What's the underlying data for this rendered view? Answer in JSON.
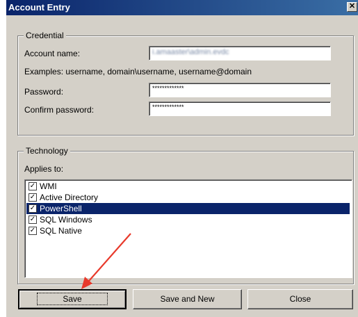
{
  "window": {
    "title": "Account Entry",
    "close_glyph": "✕",
    "close_icon": "close-icon"
  },
  "credential": {
    "legend": "Credential",
    "account_name_label": "Account name:",
    "account_name_value": "i.amaaster\\admin.evdc",
    "examples": "Examples:  username,  domain\\username,  username@domain",
    "password_label": "Password:",
    "password_value": "*************",
    "confirm_label": "Confirm password:",
    "confirm_value": "*************"
  },
  "technology": {
    "legend": "Technology",
    "applies_to_label": "Applies to:",
    "items": [
      {
        "label": "WMI",
        "checked": true,
        "check": "✓"
      },
      {
        "label": "Active Directory",
        "checked": true,
        "check": "✓"
      },
      {
        "label": "PowerShell",
        "checked": true,
        "check": "✓",
        "selected": true
      },
      {
        "label": "SQL Windows",
        "checked": true,
        "check": "✓"
      },
      {
        "label": "SQL Native",
        "checked": true,
        "check": "✓"
      }
    ]
  },
  "buttons": {
    "save": "Save",
    "save_and_new": "Save and New",
    "close": "Close"
  },
  "colors": {
    "selection": "#0a246a",
    "arrow": "#e8392b",
    "dialog_bg": "#d4d0c8"
  }
}
